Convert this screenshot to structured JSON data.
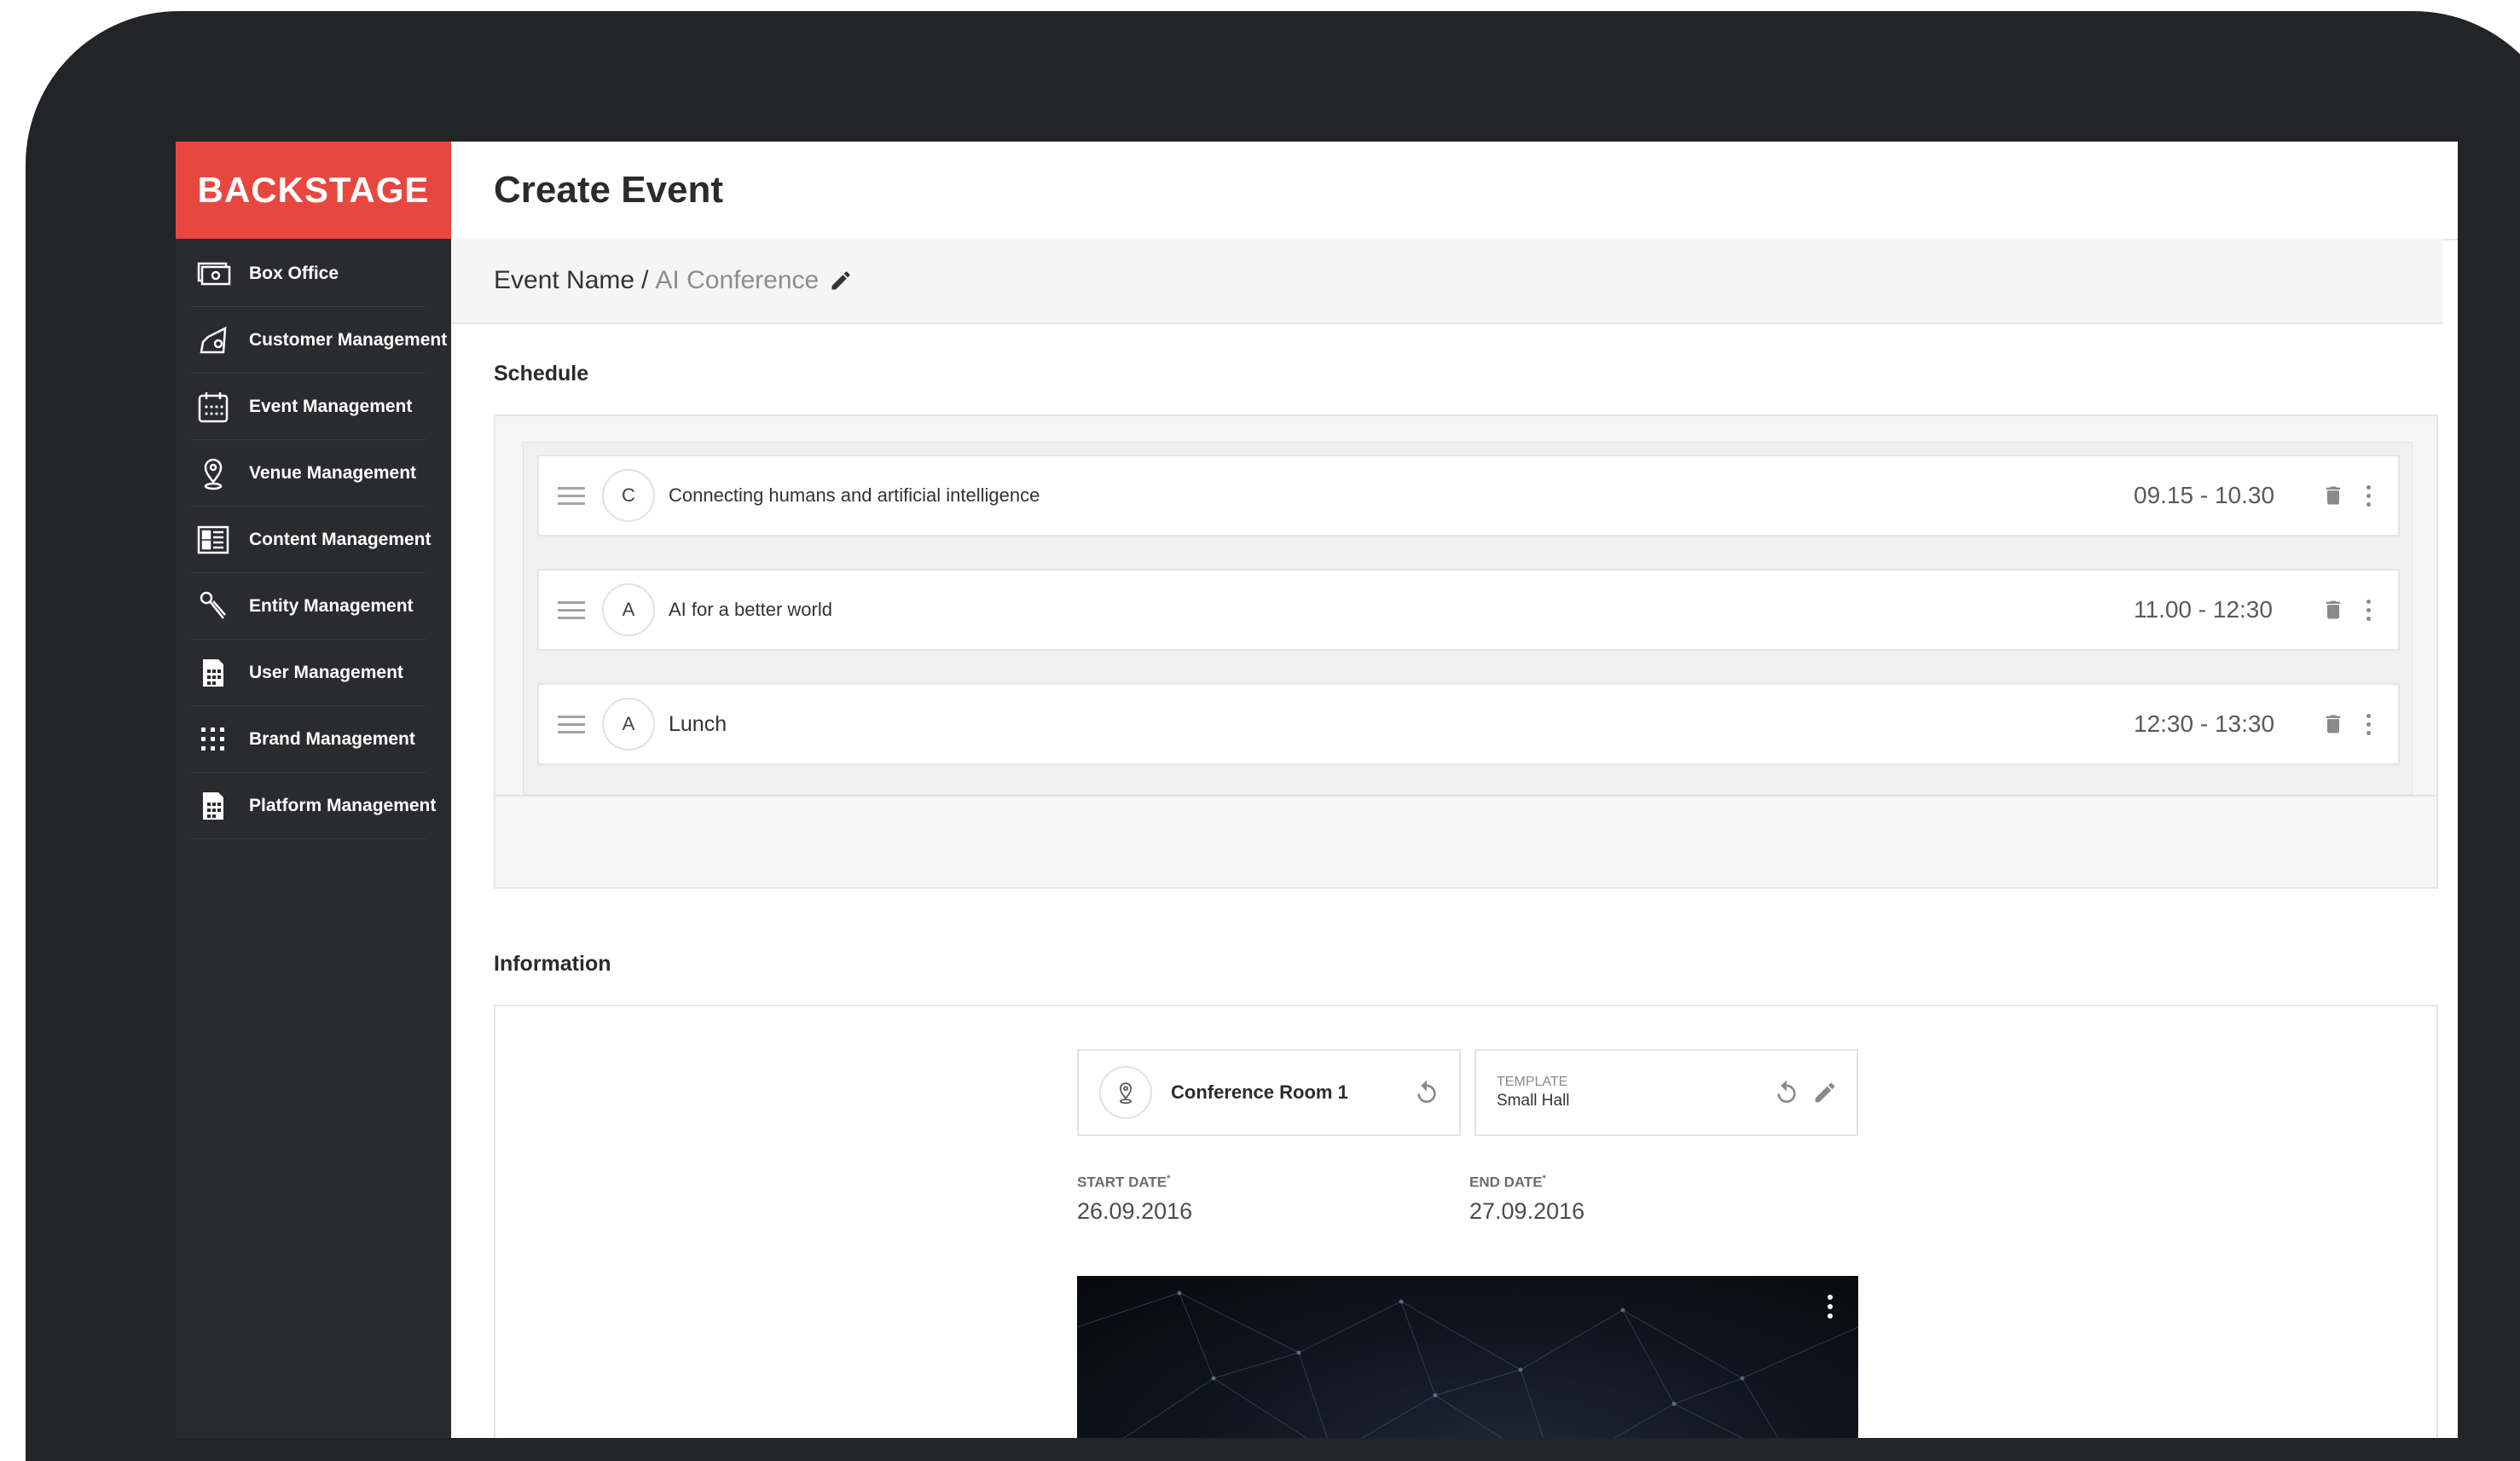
{
  "app": {
    "brand": "BACKSTAGE",
    "brand_color": "#e8473f"
  },
  "sidebar": {
    "items": [
      {
        "label": "Box Office",
        "icon": "ticket-icon"
      },
      {
        "label": "Customer Management",
        "icon": "customer-icon"
      },
      {
        "label": "Event Management",
        "icon": "calendar-icon"
      },
      {
        "label": "Venue Management",
        "icon": "location-pin-icon"
      },
      {
        "label": "Content Management",
        "icon": "content-grid-icon"
      },
      {
        "label": "Entity Management",
        "icon": "microphone-icon"
      },
      {
        "label": "User Management",
        "icon": "user-card-icon"
      },
      {
        "label": "Brand Management",
        "icon": "dots-grid-icon"
      },
      {
        "label": "Platform Management",
        "icon": "platform-icon"
      }
    ]
  },
  "header": {
    "title": "Create Event"
  },
  "breadcrumb": {
    "root": "Event Name",
    "separator": "/",
    "current": "AI Conference"
  },
  "schedule": {
    "title": "Schedule",
    "items": [
      {
        "initial": "C",
        "title": "Connecting humans and artificial intelligence",
        "time": "09.15 - 10.30"
      },
      {
        "initial": "A",
        "title": "AI for a better world",
        "time": "11.00 - 12:30"
      },
      {
        "initial": "A",
        "title": "Lunch",
        "time": "12:30 - 13:30"
      }
    ]
  },
  "information": {
    "title": "Information",
    "location": "Conference Room 1",
    "template": {
      "label": "TEMPLATE",
      "value": "Small Hall"
    },
    "start_date": {
      "label": "START DATE",
      "required_mark": "*",
      "value": "26.09.2016"
    },
    "end_date": {
      "label": "END DATE",
      "required_mark": "*",
      "value": "27.09.2016"
    }
  }
}
